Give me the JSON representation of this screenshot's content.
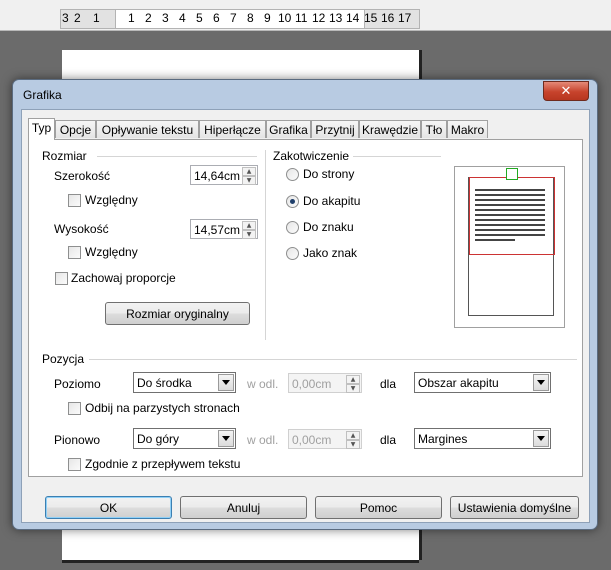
{
  "ruler": {
    "numbers": [
      "3",
      "2",
      "1",
      "1",
      "2",
      "3",
      "4",
      "5",
      "6",
      "7",
      "8",
      "9",
      "10",
      "11",
      "12",
      "13",
      "14",
      "15",
      "16",
      "17"
    ]
  },
  "dialog": {
    "title": "Grafika",
    "close_label": "✕",
    "tabs": [
      "Typ",
      "Opcje",
      "Opływanie tekstu",
      "Hiperłącze",
      "Grafika",
      "Przytnij",
      "Krawędzie",
      "Tło",
      "Makro"
    ],
    "active_tab": "Typ",
    "size": {
      "heading": "Rozmiar",
      "width_label": "Szerokość",
      "width_value": "14,64cm",
      "width_relative_label": "Względny",
      "height_label": "Wysokość",
      "height_value": "14,57cm",
      "height_relative_label": "Względny",
      "keep_ratio_label": "Zachowaj proporcje",
      "original_size_button": "Rozmiar oryginalny"
    },
    "anchor": {
      "heading": "Zakotwiczenie",
      "options": [
        "Do strony",
        "Do akapitu",
        "Do znaku",
        "Jako znak"
      ],
      "selected": "Do akapitu"
    },
    "position": {
      "heading": "Pozycja",
      "horizontal_label": "Poziomo",
      "horizontal_value": "Do środka",
      "h_by_label": "w odl.",
      "h_by_value": "0,00cm",
      "h_to_label": "dla",
      "h_to_value": "Obszar akapitu",
      "mirror_label": "Odbij na parzystych stronach",
      "vertical_label": "Pionowo",
      "vertical_value": "Do góry",
      "v_by_label": "w odl.",
      "v_by_value": "0,00cm",
      "v_to_label": "dla",
      "v_to_value": "Margines",
      "follow_flow_label": "Zgodnie z przepływem tekstu"
    },
    "buttons": {
      "ok": "OK",
      "cancel": "Anuluj",
      "help": "Pomoc",
      "defaults": "Ustawienia domyślne"
    }
  }
}
